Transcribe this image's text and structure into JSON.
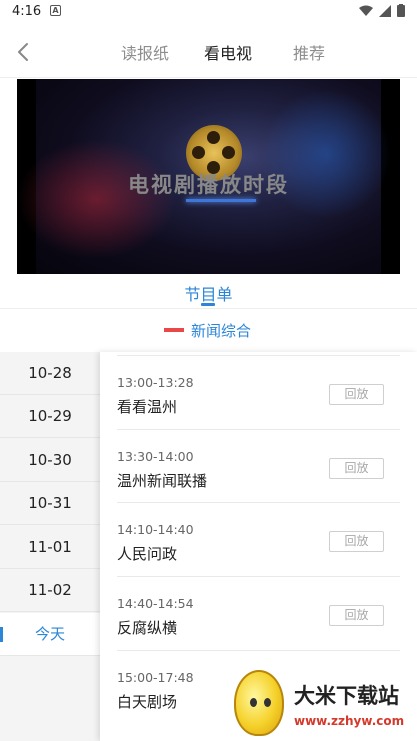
{
  "status_bar": {
    "time": "4:16",
    "sim_icon": "A"
  },
  "header": {
    "back_icon": "chevron-left-icon",
    "tabs": [
      {
        "label": "读报纸",
        "active": false
      },
      {
        "label": "看电视",
        "active": true
      },
      {
        "label": "推荐",
        "active": false
      }
    ]
  },
  "video": {
    "title": "电视剧播放时段"
  },
  "program_tab": {
    "label": "节目单"
  },
  "channel": {
    "name": "新闻综合",
    "logo_color": "#e94848"
  },
  "dates": [
    {
      "label": "10-28",
      "active": false
    },
    {
      "label": "10-29",
      "active": false
    },
    {
      "label": "10-30",
      "active": false
    },
    {
      "label": "10-31",
      "active": false
    },
    {
      "label": "11-01",
      "active": false
    },
    {
      "label": "11-02",
      "active": false
    },
    {
      "label": "今天",
      "active": true
    }
  ],
  "programs": [
    {
      "time": "13:00-13:28",
      "title": "看看温州",
      "action": "回放"
    },
    {
      "time": "13:30-14:00",
      "title": "温州新闻联播",
      "action": "回放"
    },
    {
      "time": "14:10-14:40",
      "title": "人民问政",
      "action": "回放"
    },
    {
      "time": "14:40-14:54",
      "title": "反腐纵横",
      "action": "回放"
    },
    {
      "time": "15:00-17:48",
      "title": "白天剧场",
      "action": ""
    }
  ],
  "watermark": {
    "title": "大米下载站",
    "url": "www.zzhyw.com"
  },
  "colors": {
    "accent": "#2b86d8",
    "text": "#222222",
    "muted": "#8d8d8d"
  }
}
